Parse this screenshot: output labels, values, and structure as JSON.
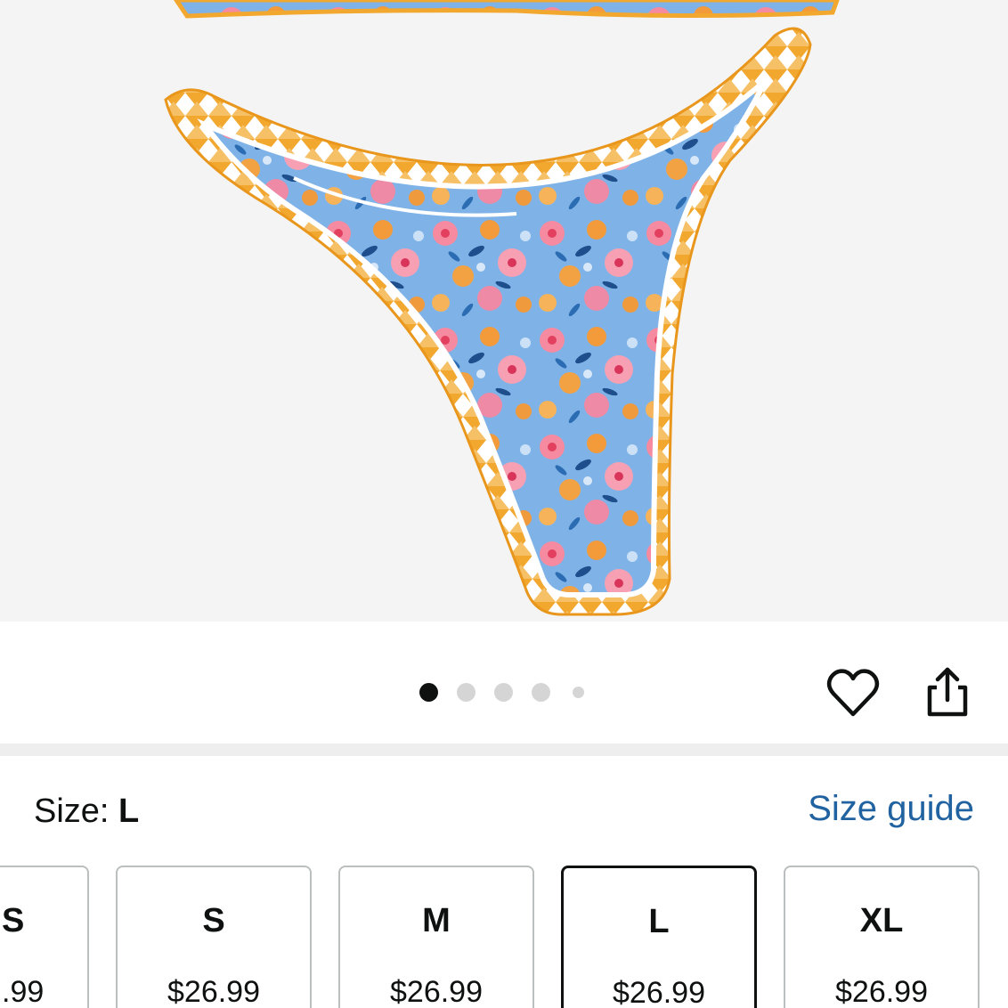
{
  "product_image": {
    "alt": "Floral print bikini bottom with orange zigzag trim",
    "carousel": {
      "count": 5,
      "active_index": 0
    }
  },
  "actions": {
    "favorite_icon": "heart-outline-icon",
    "share_icon": "share-icon"
  },
  "size_selector": {
    "label": "Size:",
    "selected": "L",
    "guide_link": "Size guide",
    "options": [
      {
        "size": "S",
        "price": ".99"
      },
      {
        "size": "S",
        "price": "$26.99"
      },
      {
        "size": "M",
        "price": "$26.99"
      },
      {
        "size": "L",
        "price": "$26.99"
      },
      {
        "size": "XL",
        "price": "$26.99"
      }
    ]
  },
  "colors": {
    "link": "#2162a1",
    "image_bg": "#f4f4f4",
    "trim_orange": "#f2a72e",
    "selected_border": "#0f1111"
  }
}
